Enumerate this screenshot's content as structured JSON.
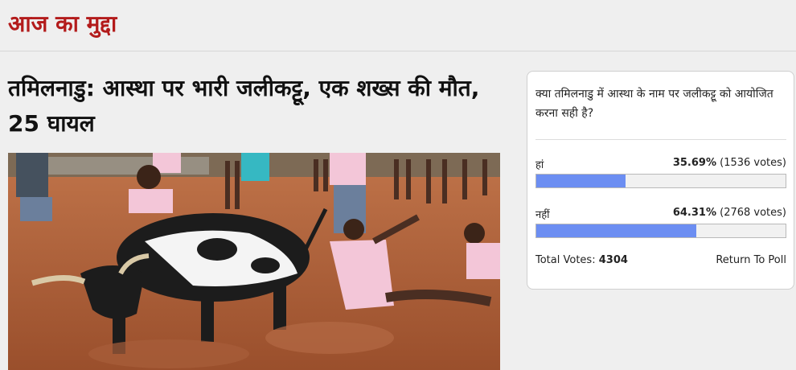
{
  "section": {
    "title": "आज का मुद्दा"
  },
  "article": {
    "headline": "तमिलनाडु: आस्था पर भारी जलीकट्टू, एक शख्स की मौत, 25 घायल",
    "image_desc": "jallikattu-bull-photo"
  },
  "poll": {
    "question": "क्या तमिलनाडु में आस्था के नाम पर जलीकट्टू को आयोजित करना सही है?",
    "options": [
      {
        "label": "हां",
        "percent_text": "35.69%",
        "votes_text": "(1536 votes)",
        "fraction": 0.3569
      },
      {
        "label": "नहीं",
        "percent_text": "64.31%",
        "votes_text": "(2768 votes)",
        "fraction": 0.6431
      }
    ],
    "total_label": "Total Votes:",
    "total_value": "4304",
    "return_label": "Return To Poll",
    "bar_color": "#6c8ef2"
  }
}
